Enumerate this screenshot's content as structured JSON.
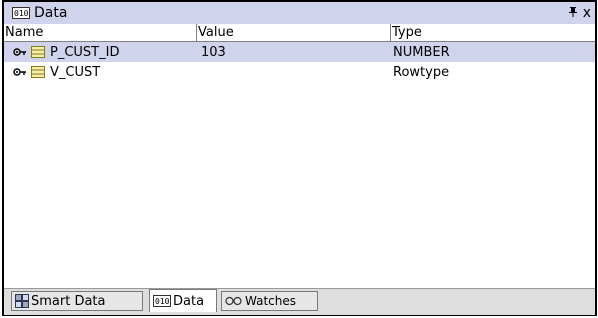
{
  "panel": {
    "title": "Data",
    "title_icon": "data-icon",
    "pin_icon": "pin-icon",
    "close_icon": "close-icon",
    "pin_glyph": "ꟼ",
    "close_glyph": "x"
  },
  "columns": {
    "name": "Name",
    "value": "Value",
    "type": "Type"
  },
  "rows": [
    {
      "name": "P_CUST_ID",
      "value": "103",
      "type": "NUMBER",
      "selected": true
    },
    {
      "name": "V_CUST",
      "value": "",
      "type": "Rowtype",
      "selected": false
    }
  ],
  "tabs": [
    {
      "label": "Smart Data",
      "icon": "smart-data-icon",
      "active": false
    },
    {
      "label": "Data",
      "icon": "data-icon",
      "active": true
    },
    {
      "label": "Watches",
      "icon": "watches-icon",
      "active": false
    }
  ],
  "colors": {
    "title_bg": "#cfd3ec",
    "selection_bg": "#cfd3ec",
    "border": "#000000"
  }
}
